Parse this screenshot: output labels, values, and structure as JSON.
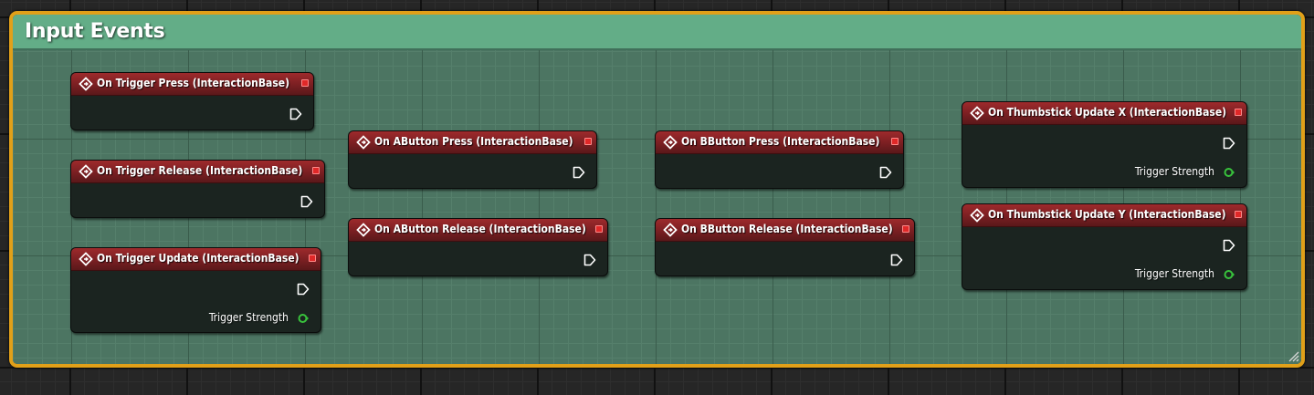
{
  "comment": {
    "title": "Input Events"
  },
  "nodes": [
    {
      "title": "On Trigger Press (InteractionBase)"
    },
    {
      "title": "On Trigger Release (InteractionBase)"
    },
    {
      "title": "On Trigger Update (InteractionBase)",
      "output": "Trigger Strength"
    },
    {
      "title": "On AButton Press (InteractionBase)"
    },
    {
      "title": "On AButton Release (InteractionBase)"
    },
    {
      "title": "On BButton Press (InteractionBase)"
    },
    {
      "title": "On BButton Release (InteractionBase)"
    },
    {
      "title": "On Thumbstick Update X (InteractionBase)",
      "output": "Trigger Strength"
    },
    {
      "title": "On Thumbstick Update Y (InteractionBase)",
      "output": "Trigger Strength"
    }
  ],
  "colors": {
    "comment_border": "#e1a019",
    "comment_header": "#63ad87",
    "node_header": "#8b2426",
    "float_pin": "#38c23c",
    "delegate_pin": "#e02828"
  },
  "icons": {
    "event": "event-diamond-icon",
    "exec": "exec-output-icon",
    "delegate": "delegate-pin-icon",
    "float": "float-pin-icon"
  }
}
